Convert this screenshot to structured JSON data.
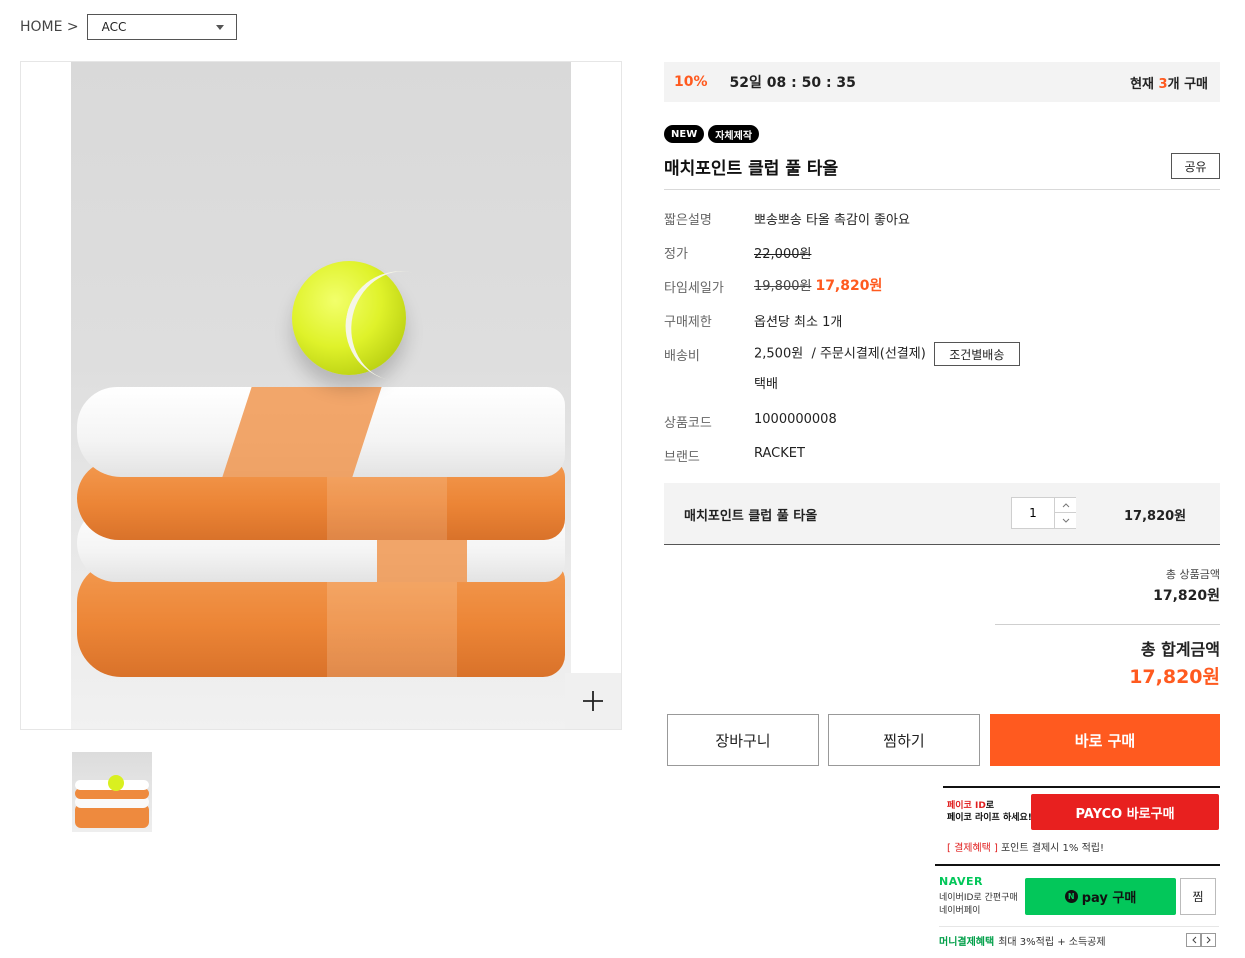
{
  "breadcrumb": {
    "home": "HOME >",
    "category": "ACC"
  },
  "timer": {
    "discount": "10%",
    "countdown": "52일 08 : 50 : 35",
    "buyers_prefix": "현재 ",
    "buyers_count": "3",
    "buyers_suffix": "개 구매"
  },
  "badges": [
    "NEW",
    "자체제작"
  ],
  "product": {
    "title": "매치포인트 클럽 풀 타올",
    "share": "공유"
  },
  "info": {
    "desc_label": "짧은설명",
    "desc": "뽀송뽀송 타올 촉감이 좋아요",
    "price_label": "정가",
    "price": "22,000원",
    "sale_label": "타임세일가",
    "sale_original": "19,800원",
    "sale_price": "17,820원",
    "limit_label": "구매제한",
    "limit": "옵션당 최소 1개",
    "ship_label": "배송비",
    "ship_fee": "2,500원",
    "ship_method": "/ 주문시결제(선결제)",
    "ship_button": "조건별배송",
    "ship_type": "택배",
    "code_label": "상품코드",
    "code": "1000000008",
    "brand_label": "브랜드",
    "brand": "RACKET"
  },
  "option": {
    "name": "매치포인트 클럽 풀 타올",
    "quantity": "1",
    "price": "17,820원"
  },
  "summary": {
    "product_total_label": "총 상품금액",
    "product_total": "17,820원",
    "grand_total_label": "총 합계금액",
    "grand_total": "17,820원"
  },
  "actions": {
    "cart": "장바구니",
    "wishlist": "찜하기",
    "buy_now": "바로 구매"
  },
  "payco": {
    "promo_line1_a": "페이코 ID",
    "promo_line1_b": "로",
    "promo_line2": "페이코 라이프 하세요!",
    "button": "PAYCO 바로구매",
    "benefit_tag": "[ 결제혜택 ]",
    "benefit": "포인트 결제시 1% 적립!"
  },
  "npay": {
    "logo": "NAVER",
    "desc_line1": "네이버ID로 간편구매",
    "desc_line2": "네이버페이",
    "button": "pay 구매",
    "wish": "찜",
    "benefit_tag": "머니결제혜택",
    "benefit": "최대 3%적립 + 소득공제"
  },
  "colors": {
    "accent": "#ff5a1f",
    "payco_red": "#e8201f",
    "naver_green": "#03c75a",
    "timer_bg": "#f3f3f3"
  },
  "icons": {
    "zoom": "plus-icon",
    "dropdown": "caret-down-icon",
    "qty_up": "chevron-up-icon",
    "qty_down": "chevron-down-icon",
    "prev": "chevron-left-icon",
    "next": "chevron-right-icon"
  }
}
